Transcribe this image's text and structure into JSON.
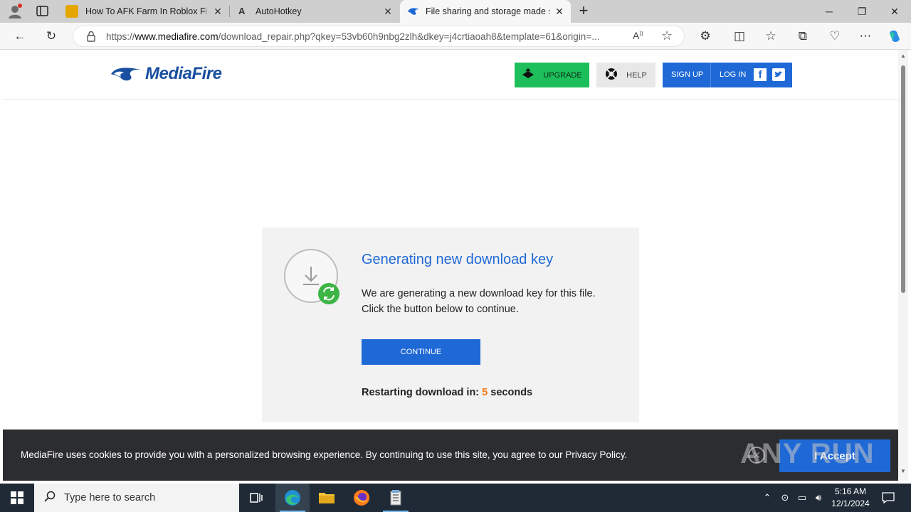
{
  "browser": {
    "tabs": [
      {
        "title": "How To AFK Farm In Roblox Fisch",
        "active": false
      },
      {
        "title": "AutoHotkey",
        "active": false
      },
      {
        "title": "File sharing and storage made simple",
        "active": true
      }
    ],
    "address": {
      "scheme": "https://",
      "host": "www.mediafire.com",
      "path": "/download_repair.php?qkey=53vb60h9nbg2zlh&dkey=j4crtiaoah8&template=61&origin=..."
    }
  },
  "site": {
    "logo_text": "MediaFire",
    "header": {
      "upgrade_label": "UPGRADE",
      "help_label": "HELP",
      "signup_label": "SIGN UP",
      "login_label": "LOG IN"
    },
    "card": {
      "title": "Generating new download key",
      "desc_line1": "We are generating a new download key for this file.",
      "desc_line2": "Click the button below to continue.",
      "continue_label": "CONTINUE",
      "restart_prefix": "Restarting download in:",
      "restart_count": "5",
      "restart_suffix": "seconds"
    },
    "cookie": {
      "text": "MediaFire uses cookies to provide you with a personalized browsing experience. By continuing to use this site, you agree to our Privacy Policy.",
      "accept_label": "I Accept",
      "watermark": "ANY RUN"
    }
  },
  "taskbar": {
    "search_placeholder": "Type here to search",
    "time": "5:16 AM",
    "date": "12/1/2024"
  },
  "colors": {
    "mediafire_blue": "#1f69d6",
    "upgrade_green": "#1dbf5a",
    "countdown_orange": "#ef7b1a"
  }
}
